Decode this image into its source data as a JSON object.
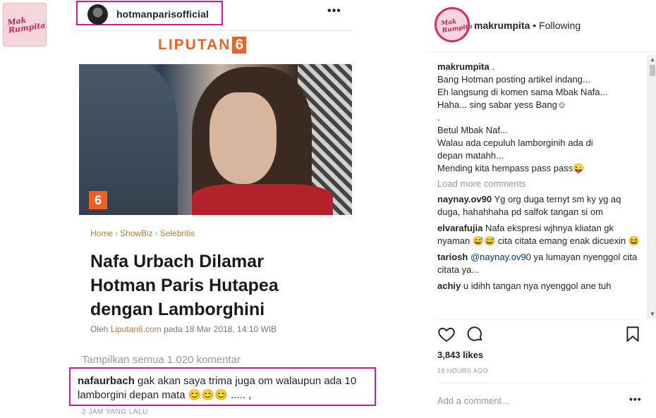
{
  "left_thumb": {
    "logo_line1": "Mak",
    "logo_line2": "Rumpita"
  },
  "post_image": {
    "header_username": "hotmanparisofficial",
    "more": "•••",
    "publisher_logo": "LIPUTAN",
    "publisher_logo_num": "6",
    "photo_badge": "6",
    "breadcrumb": [
      "Home",
      "ShowBiz",
      "Selebritis"
    ],
    "breadcrumb_sep": "›",
    "headline": "Nafa Urbach Dilamar Hotman Paris Hutapea dengan Lamborghini",
    "byline_prefix": "Oleh ",
    "byline_source": "Liputan6.com",
    "byline_suffix": " pada 18 Mar 2018, 14:10 WIB",
    "show_all_comments": "Tampilkan semua 1.020 komentar",
    "highlight_comment_user": "nafaurbach",
    "highlight_comment_text": " gak akan saya trima juga om walaupun ada 10 lamborgini depan mata 😊😊😊 ..... ,",
    "highlight_comment_time": "2 JAM YANG LALU"
  },
  "side_panel": {
    "avatar_logo_line1": "Mak",
    "avatar_logo_line2": "Rumpita",
    "username": "makrumpita",
    "follow_status": " • Following",
    "caption_user": "makrumpita",
    "caption_user_suffix": " .",
    "caption_lines": [
      "Bang Hotman posting artikel indang...",
      "Eh langsung di komen sama Mbak Nafa...",
      "Haha... sing sabar yess Bang☺",
      ".",
      "Betul Mbak Naf...",
      "Walau ada cepuluh lamborginih ada di",
      "depan matahh...",
      "Mending kita hempass pass pass😜"
    ],
    "load_more": "Load more comments",
    "comments": [
      {
        "user": "naynay.ov90",
        "text": " Yg org duga ternyt sm ky yg aq duga, hahahhaha pd salfok tangan si om"
      },
      {
        "user": "elvarafujia",
        "text": " Nafa ekspresi wjhnya kliatan gk nyaman 😅😅 cita citata emang enak dicuexin 😆"
      },
      {
        "user": "tariosh",
        "mention": " @naynay.ov90",
        "text": " ya lumayan nyenggol cita citata ya..."
      },
      {
        "user": "achiy",
        "text": " u idihh tangan nya nyenggol ane tuh"
      }
    ],
    "likes": "3,843 likes",
    "post_time": "18 HOURS AGO",
    "add_comment_placeholder": "Add a comment...",
    "more": "•••"
  }
}
